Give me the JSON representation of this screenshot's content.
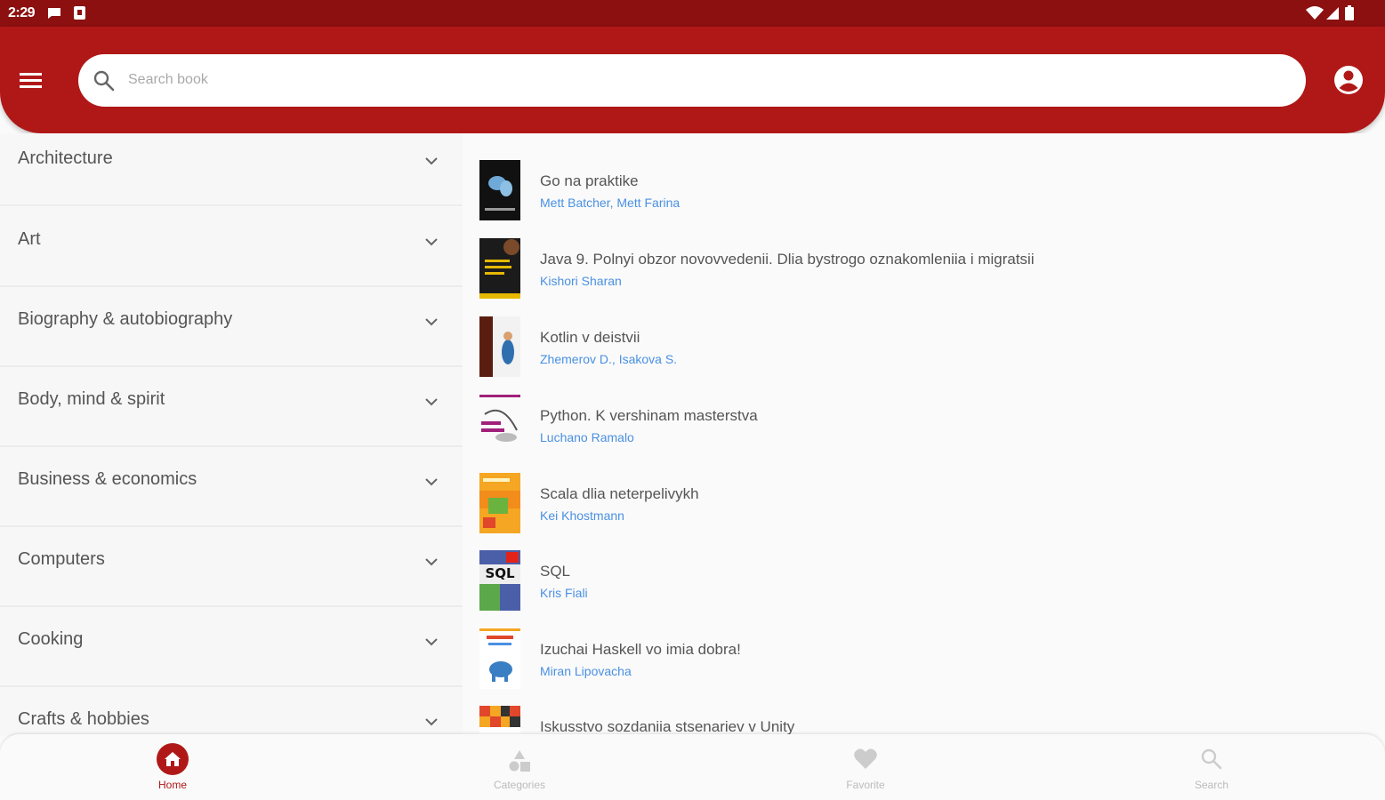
{
  "status_bar": {
    "time": "2:29"
  },
  "search": {
    "placeholder": "Search book",
    "value": ""
  },
  "categories": [
    {
      "label": "Architecture"
    },
    {
      "label": "Art"
    },
    {
      "label": "Biography & autobiography"
    },
    {
      "label": "Body, mind & spirit"
    },
    {
      "label": "Business & economics"
    },
    {
      "label": "Computers"
    },
    {
      "label": "Cooking"
    },
    {
      "label": "Crafts & hobbies"
    }
  ],
  "books": [
    {
      "title": "Go na praktike",
      "author": "Mett Batcher, Mett Farina"
    },
    {
      "title": "Java 9. Polnyi obzor novovvedenii. Dlia bystrogo oznakomleniia i migratsii",
      "author": "Kishori Sharan"
    },
    {
      "title": "Kotlin v deistvii",
      "author": "Zhemerov D., Isakova S."
    },
    {
      "title": "Python. K vershinam masterstva",
      "author": "Luchano Ramalo"
    },
    {
      "title": "Scala dlia neterpelivykh",
      "author": "Kei Khostmann"
    },
    {
      "title": "SQL",
      "author": "Kris Fiali",
      "cover_text": "SQL"
    },
    {
      "title": "Izuchai Haskell vo imia dobra!",
      "author": "Miran Lipovacha"
    },
    {
      "title": "Iskusstvo sozdaniia stsenariev v Unity",
      "author": ""
    }
  ],
  "bottom_nav": {
    "home": "Home",
    "categories": "Categories",
    "favorite": "Favorite",
    "search": "Search"
  },
  "colors": {
    "primary": "#b01818",
    "status_bar": "#8c1010",
    "author_link": "#4a90e2",
    "inactive_nav": "#bbbbbb"
  }
}
